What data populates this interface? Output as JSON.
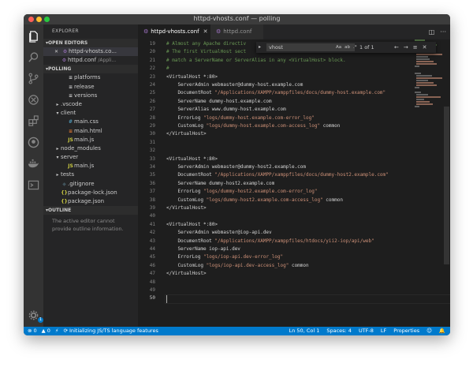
{
  "window": {
    "title": "httpd-vhosts.conf — polling"
  },
  "activity_bar": {
    "icons": [
      "files-icon",
      "search-icon",
      "source-control-icon",
      "debug-icon",
      "extensions-icon",
      "github-icon",
      "docker-icon",
      "terminal-icon",
      "gear-icon"
    ],
    "gear_badge": "1"
  },
  "sidebar": {
    "header": "EXPLORER",
    "open_editors_title": "OPEN EDITORS",
    "open_editors": [
      {
        "name": "httpd-vhosts.co...",
        "close": "✕"
      },
      {
        "name": "httpd.conf",
        "desc": "/Appli..."
      }
    ],
    "project_title": "POLLING",
    "tree": [
      {
        "label": "platforms",
        "icon": "≡",
        "type": "file",
        "depth": 1
      },
      {
        "label": "release",
        "icon": "≡",
        "type": "file",
        "depth": 1
      },
      {
        "label": "versions",
        "icon": "≡",
        "type": "file",
        "depth": 1
      },
      {
        "label": ".vscode",
        "type": "folder-closed",
        "depth": 0
      },
      {
        "label": "client",
        "type": "folder-open",
        "depth": 0
      },
      {
        "label": "main.css",
        "icon": "#",
        "iconColor": "#519aba",
        "type": "file",
        "depth": 1
      },
      {
        "label": "main.html",
        "icon": "≡",
        "iconColor": "#e37933",
        "type": "file",
        "depth": 1
      },
      {
        "label": "main.js",
        "icon": "JS",
        "iconColor": "#cbcb41",
        "type": "file",
        "depth": 1
      },
      {
        "label": "node_modules",
        "type": "folder-closed",
        "depth": 0
      },
      {
        "label": "server",
        "type": "folder-open",
        "depth": 0
      },
      {
        "label": "main.js",
        "icon": "JS",
        "iconColor": "#cbcb41",
        "type": "file",
        "depth": 1
      },
      {
        "label": "tests",
        "type": "folder-closed",
        "depth": 0
      },
      {
        "label": ".gitignore",
        "icon": "◆",
        "iconColor": "#41535b",
        "type": "file",
        "depth": 0
      },
      {
        "label": "package-lock.json",
        "icon": "{}",
        "iconColor": "#cbcb41",
        "type": "file",
        "depth": 0
      },
      {
        "label": "package.json",
        "icon": "{}",
        "iconColor": "#cbcb41",
        "type": "file",
        "depth": 0
      }
    ],
    "outline_title": "OUTLINE",
    "outline_empty": "The active editor cannot provide outline information."
  },
  "tabs": [
    {
      "label": "httpd-vhosts.conf",
      "active": true,
      "close": "✕"
    },
    {
      "label": "httpd.conf",
      "active": false
    }
  ],
  "find_widget": {
    "toggle": "▸",
    "query": "vhost",
    "options": [
      "Aa",
      "ab",
      ".*"
    ],
    "count": "1 of 1",
    "nav": [
      "←",
      "→",
      "≡",
      "✕"
    ]
  },
  "editor_lines": [
    {
      "n": "19",
      "t": "# Almost any Apache directiv",
      "k": "comment"
    },
    {
      "n": "20",
      "t": "# The first VirtualHost sect",
      "k": "comment"
    },
    {
      "n": "21",
      "t": "# match a ServerName or ServerAlias in any <VirtualHost> block.",
      "k": "comment"
    },
    {
      "n": "22",
      "t": "#",
      "k": "comment"
    },
    {
      "n": "23",
      "t": "<VirtualHost *:80>",
      "k": "tag"
    },
    {
      "n": "24",
      "t": "    ServerAdmin webmaster@dummy-host.example.com",
      "k": "plain"
    },
    {
      "n": "25",
      "t": "    DocumentRoot \"/Applications/XAMPP/xamppfiles/docs/dummy-host.example.com\"",
      "k": "mixed"
    },
    {
      "n": "26",
      "t": "    ServerName dummy-host.example.com",
      "k": "plain"
    },
    {
      "n": "27",
      "t": "    ServerAlias www.dummy-host.example.com",
      "k": "plain"
    },
    {
      "n": "28",
      "t": "    ErrorLog \"logs/dummy-host.example.com-error_log\"",
      "k": "mixed"
    },
    {
      "n": "29",
      "t": "    CustomLog \"logs/dummy-host.example.com-access_log\" common",
      "k": "mixed"
    },
    {
      "n": "30",
      "t": "</VirtualHost>",
      "k": "tag"
    },
    {
      "n": "31",
      "t": "",
      "k": "plain"
    },
    {
      "n": "32",
      "t": "",
      "k": "plain"
    },
    {
      "n": "33",
      "t": "<VirtualHost *:80>",
      "k": "tag"
    },
    {
      "n": "34",
      "t": "    ServerAdmin webmaster@dummy-host2.example.com",
      "k": "plain"
    },
    {
      "n": "35",
      "t": "    DocumentRoot \"/Applications/XAMPP/xamppfiles/docs/dummy-host2.example.com\"",
      "k": "mixed"
    },
    {
      "n": "36",
      "t": "    ServerName dummy-host2.example.com",
      "k": "plain"
    },
    {
      "n": "37",
      "t": "    ErrorLog \"logs/dummy-host2.example.com-error_log\"",
      "k": "mixed"
    },
    {
      "n": "38",
      "t": "    CustomLog \"logs/dummy-host2.example.com-access_log\" common",
      "k": "mixed"
    },
    {
      "n": "39",
      "t": "</VirtualHost>",
      "k": "tag"
    },
    {
      "n": "40",
      "t": "",
      "k": "plain"
    },
    {
      "n": "41",
      "t": "<VirtualHost *:80>",
      "k": "tag"
    },
    {
      "n": "42",
      "t": "    ServerAdmin webmaster@iop-api.dev",
      "k": "plain"
    },
    {
      "n": "43",
      "t": "    DocumentRoot \"/Applications/XAMPP/xamppfiles/htdocs/yii2-iop/api/web\"",
      "k": "mixed"
    },
    {
      "n": "44",
      "t": "    ServerName iop-api.dev",
      "k": "plain"
    },
    {
      "n": "45",
      "t": "    ErrorLog \"logs/iop-api.dev-error_log\"",
      "k": "mixed"
    },
    {
      "n": "46",
      "t": "    CustomLog \"logs/iop-api.dev-access_log\" common",
      "k": "mixed"
    },
    {
      "n": "47",
      "t": "</VirtualHost>",
      "k": "tag"
    },
    {
      "n": "48",
      "t": "",
      "k": "plain"
    },
    {
      "n": "49",
      "t": "",
      "k": "plain"
    },
    {
      "n": "50",
      "t": "",
      "k": "plain",
      "current": true
    }
  ],
  "status_bar": {
    "errors": "⊗ 0",
    "warnings": "▲ 0",
    "bolt": "⚡",
    "task": "⟳ Initializing JS/TS language features",
    "position": "Ln 50, Col 1",
    "spaces": "Spaces: 4",
    "encoding": "UTF-8",
    "eol": "LF",
    "language": "Properties",
    "feedback": "☺",
    "bell": "🔔"
  },
  "colors": {
    "accent": "#007acc",
    "comment": "#6a9955",
    "string": "#ce9178",
    "text": "#d4d4d4"
  }
}
